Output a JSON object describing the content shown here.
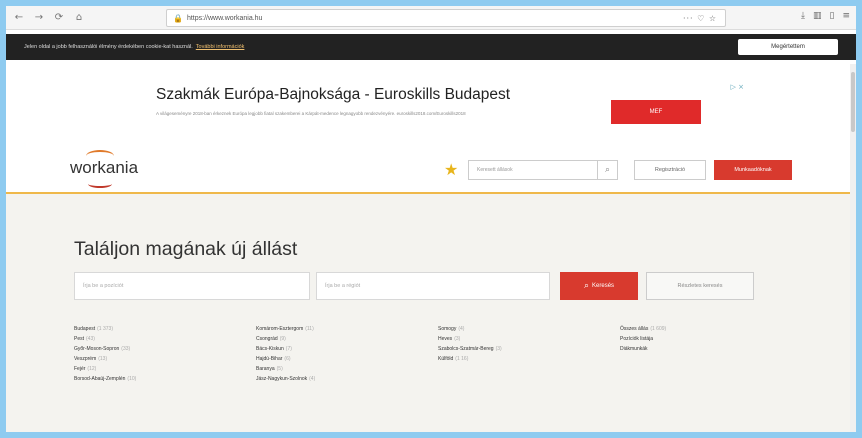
{
  "browser": {
    "url": "https://www.workania.hu",
    "icons": [
      "back-icon",
      "forward-icon",
      "reload-icon",
      "home-icon",
      "lock-icon",
      "more-icon",
      "bookmark-icon",
      "download-icon",
      "library-icon",
      "sidebar-icon",
      "menu-icon"
    ]
  },
  "cookie": {
    "text": "Jelen oldal a jobb felhasználói élmény érdekében cookie-kat használ.",
    "link": "További információk",
    "accept": "Megértettem"
  },
  "ad": {
    "headline": "Szakmák Európa-Bajnoksága - Euroskills Budapest",
    "description": "A világeseményre 2018-ban érkeznek Európa legjobb fiatal szakemberei a Kárpát-medence legnagyobb rendezvényére. euroskills2018.com/Euroskills2018",
    "cta": "MEF",
    "adchoice": "▷ ×"
  },
  "header": {
    "logo": "workania",
    "search_placeholder": "Keresett állások",
    "register": "Regisztráció",
    "employers": "Munkaadóknak"
  },
  "hero": {
    "title": "Találjon magának új állást",
    "position_placeholder": "Írja be a pozíciót",
    "location_placeholder": "Írja be a régiót",
    "search": "Keresés",
    "advanced": "Részletes keresés"
  },
  "regions": {
    "col1": [
      {
        "name": "Budapest",
        "count": "(1 373)"
      },
      {
        "name": "Pest",
        "count": "(43)"
      },
      {
        "name": "Győr-Moson-Sopron",
        "count": "(33)"
      },
      {
        "name": "Veszprém",
        "count": "(13)"
      },
      {
        "name": "Fejér",
        "count": "(12)"
      },
      {
        "name": "Borsod-Abaúj-Zemplén",
        "count": "(10)"
      }
    ],
    "col2": [
      {
        "name": "Komárom-Esztergom",
        "count": "(11)"
      },
      {
        "name": "Csongrád",
        "count": "(9)"
      },
      {
        "name": "Bács-Kiskun",
        "count": "(7)"
      },
      {
        "name": "Hajdú-Bihar",
        "count": "(6)"
      },
      {
        "name": "Baranya",
        "count": "(5)"
      },
      {
        "name": "Jász-Nagykun-Szolnok",
        "count": "(4)"
      }
    ],
    "col3": [
      {
        "name": "Somogy",
        "count": "(4)"
      },
      {
        "name": "Heves",
        "count": "(3)"
      },
      {
        "name": "Szabolcs-Szatmár-Bereg",
        "count": "(3)"
      },
      {
        "name": "Külföld",
        "count": "(1 16)"
      }
    ],
    "col4": [
      {
        "name": "Összes állás",
        "count": "(1 609)"
      },
      {
        "name": "Pozíciók listája",
        "count": ""
      },
      {
        "name": "Diákmunkák",
        "count": ""
      }
    ]
  }
}
